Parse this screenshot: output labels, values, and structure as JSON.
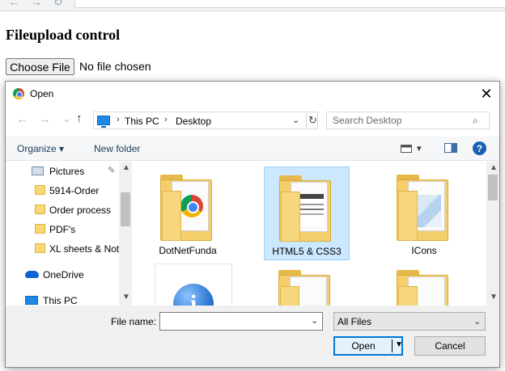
{
  "page": {
    "heading": "Fileupload control",
    "choose_file_label": "Choose File",
    "no_file_text": "No file chosen"
  },
  "dialog": {
    "title": "Open",
    "close_glyph": "✕",
    "breadcrumb": [
      "This PC",
      "Desktop"
    ],
    "breadcrumb_separator": "›",
    "search": {
      "placeholder": "Search Desktop"
    },
    "toolbar": {
      "organize_label": "Organize ▾",
      "new_folder_label": "New folder",
      "view_arrow": "▾",
      "help_glyph": "?"
    },
    "nav_pane": {
      "items": [
        {
          "label": "Pictures",
          "pinned": true
        },
        {
          "label": "5914-Order"
        },
        {
          "label": "Order process"
        },
        {
          "label": "PDF's"
        },
        {
          "label": "XL sheets & Not"
        },
        {
          "label": "OneDrive"
        },
        {
          "label": "This PC"
        }
      ]
    },
    "files": [
      {
        "name": "DotNetFunda",
        "type": "folder",
        "selected": false
      },
      {
        "name": "HTML5 & CSS3",
        "type": "folder",
        "selected": true
      },
      {
        "name": "ICons",
        "type": "folder",
        "selected": false
      }
    ],
    "bottom": {
      "filename_label": "File name:",
      "filename_value": "",
      "filetype_value": "All Files",
      "open_label": "Open",
      "cancel_label": "Cancel"
    }
  },
  "colors": {
    "selection_bg": "#cce8ff",
    "open_border": "#0078d7",
    "folder_yellow": "#f5cf6b"
  }
}
